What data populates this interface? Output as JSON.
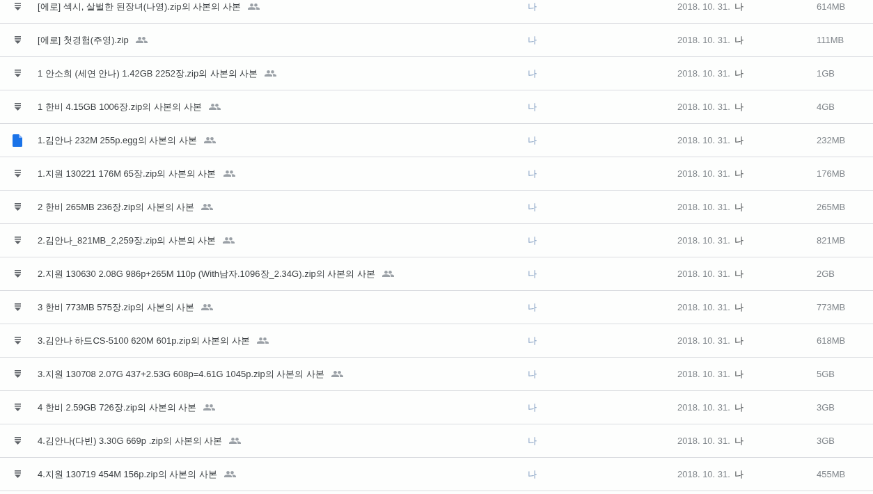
{
  "file_list": {
    "rows": [
      {
        "kind": "archive",
        "name": "[에로] 섹시, 살벌한 된장녀(나영).zip의 사본의 사본",
        "shared": true,
        "owner": "나",
        "modified": "2018. 10. 31.",
        "modified_by": "나",
        "size": "614MB"
      },
      {
        "kind": "archive",
        "name": "[에로] 첫경험(주영).zip",
        "shared": true,
        "owner": "나",
        "modified": "2018. 10. 31.",
        "modified_by": "나",
        "size": "111MB"
      },
      {
        "kind": "archive",
        "name": "1 안소희 (세연 안나) 1.42GB 2252장.zip의 사본의 사본",
        "shared": true,
        "owner": "나",
        "modified": "2018. 10. 31.",
        "modified_by": "나",
        "size": "1GB"
      },
      {
        "kind": "archive",
        "name": "1 한비 4.15GB 1006장.zip의 사본의 사본",
        "shared": true,
        "owner": "나",
        "modified": "2018. 10. 31.",
        "modified_by": "나",
        "size": "4GB"
      },
      {
        "kind": "document",
        "name": "1.김안나 232M 255p.egg의 사본의 사본",
        "shared": true,
        "owner": "나",
        "modified": "2018. 10. 31.",
        "modified_by": "나",
        "size": "232MB"
      },
      {
        "kind": "archive",
        "name": "1.지원 130221 176M 65장.zip의 사본의 사본",
        "shared": true,
        "owner": "나",
        "modified": "2018. 10. 31.",
        "modified_by": "나",
        "size": "176MB"
      },
      {
        "kind": "archive",
        "name": "2 한비 265MB 236장.zip의 사본의 사본",
        "shared": true,
        "owner": "나",
        "modified": "2018. 10. 31.",
        "modified_by": "나",
        "size": "265MB"
      },
      {
        "kind": "archive",
        "name": "2.김안나_821MB_2,259장.zip의 사본의 사본",
        "shared": true,
        "owner": "나",
        "modified": "2018. 10. 31.",
        "modified_by": "나",
        "size": "821MB"
      },
      {
        "kind": "archive",
        "name": "2.지원 130630 2.08G 986p+265M 110p (With남자.1096장_2.34G).zip의 사본의 사본",
        "shared": true,
        "owner": "나",
        "modified": "2018. 10. 31.",
        "modified_by": "나",
        "size": "2GB"
      },
      {
        "kind": "archive",
        "name": "3 한비 773MB 575장.zip의 사본의 사본",
        "shared": true,
        "owner": "나",
        "modified": "2018. 10. 31.",
        "modified_by": "나",
        "size": "773MB"
      },
      {
        "kind": "archive",
        "name": "3.김안나 하드CS-5100 620M 601p.zip의 사본의 사본",
        "shared": true,
        "owner": "나",
        "modified": "2018. 10. 31.",
        "modified_by": "나",
        "size": "618MB"
      },
      {
        "kind": "archive",
        "name": "3.지원 130708 2.07G 437+2.53G 608p=4.61G 1045p.zip의 사본의 사본",
        "shared": true,
        "owner": "나",
        "modified": "2018. 10. 31.",
        "modified_by": "나",
        "size": "5GB"
      },
      {
        "kind": "archive",
        "name": "4 한비 2.59GB 726장.zip의 사본의 사본",
        "shared": true,
        "owner": "나",
        "modified": "2018. 10. 31.",
        "modified_by": "나",
        "size": "3GB"
      },
      {
        "kind": "archive",
        "name": "4.김안나(다빈) 3.30G 669p .zip의 사본의 사본",
        "shared": true,
        "owner": "나",
        "modified": "2018. 10. 31.",
        "modified_by": "나",
        "size": "3GB"
      },
      {
        "kind": "archive",
        "name": "4.지원 130719 454M 156p.zip의 사본의 사본",
        "shared": true,
        "owner": "나",
        "modified": "2018. 10. 31.",
        "modified_by": "나",
        "size": "455MB"
      }
    ]
  }
}
